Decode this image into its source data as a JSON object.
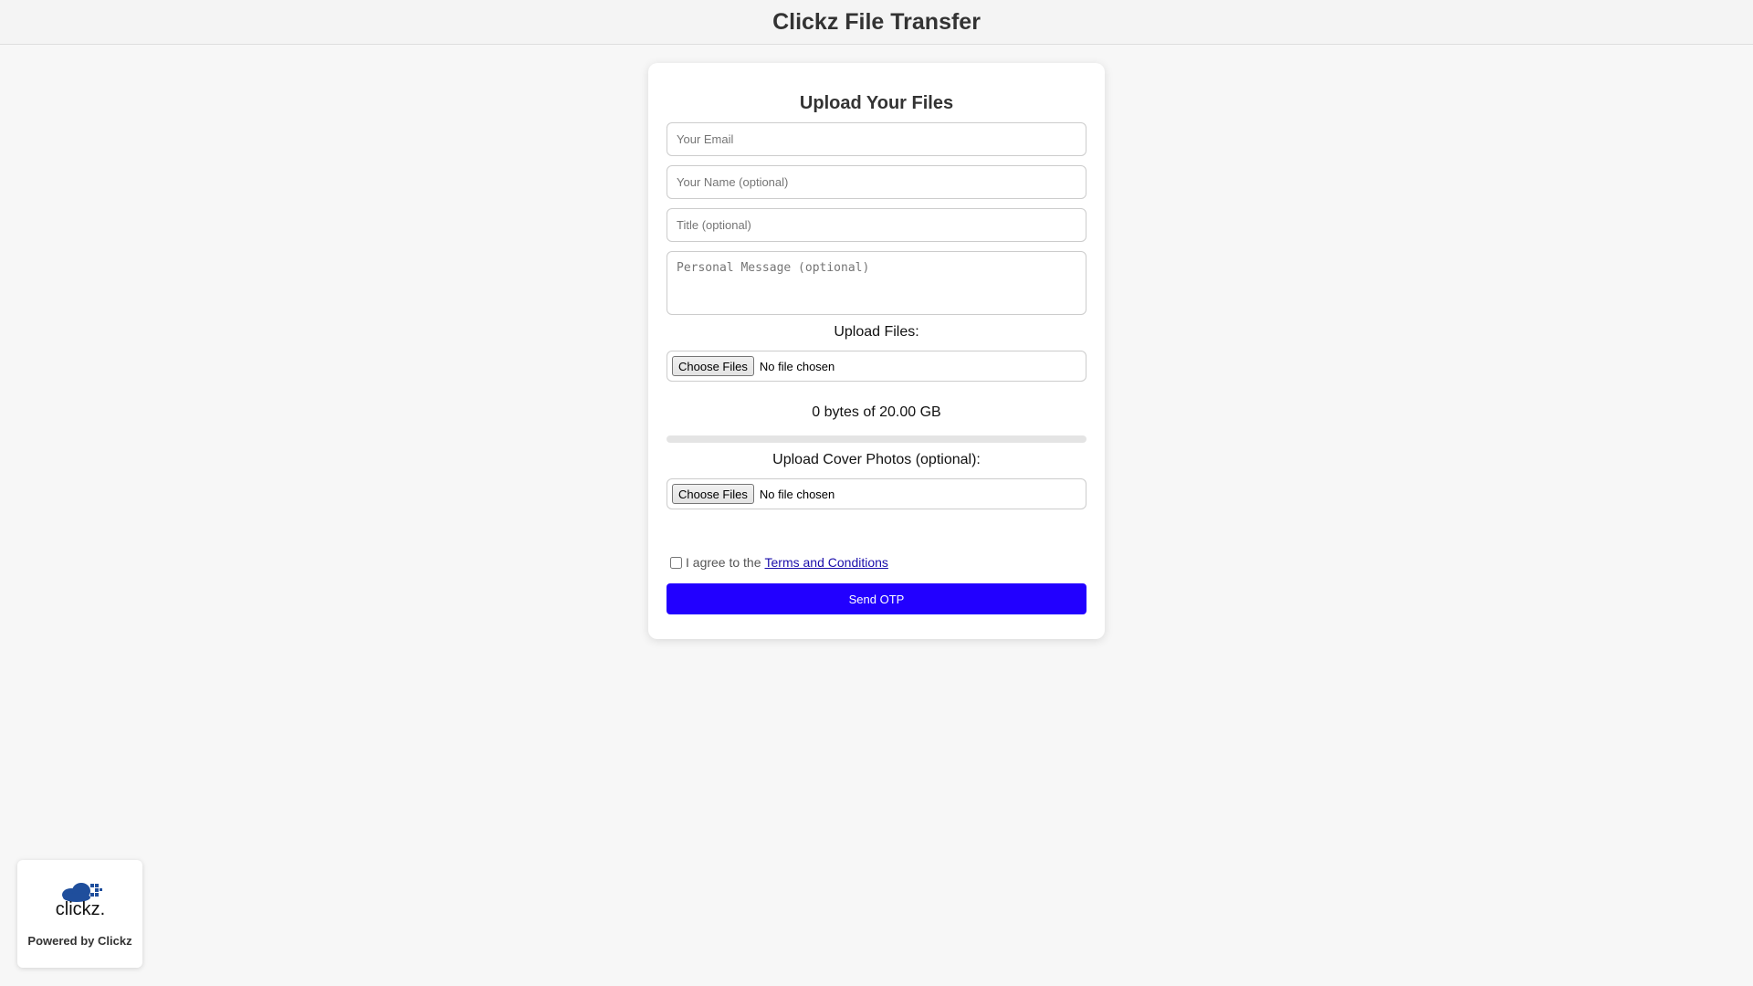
{
  "header": {
    "title": "Clickz File Transfer"
  },
  "form": {
    "title": "Upload Your Files",
    "email_placeholder": "Your Email",
    "name_placeholder": "Your Name (optional)",
    "title_placeholder": "Title (optional)",
    "message_placeholder": "Personal Message (optional)",
    "upload_files_label": "Upload Files:",
    "choose_files_label": "Choose Files",
    "no_file_text": "No file chosen",
    "bytes_text": "0 bytes of 20.00 GB",
    "upload_progress": 0,
    "cover_photos_label": "Upload Cover Photos (optional):",
    "terms_prefix": "I agree to the",
    "terms_link": "Terms and Conditions",
    "terms_checked": false,
    "send_button": "Send OTP"
  },
  "badge": {
    "logo_text": "clickz.",
    "logo_icon": "cloud-icon",
    "caption": "Powered by Clickz"
  },
  "colors": {
    "accent": "#2200ff",
    "logo_blue": "#1f4e9c"
  }
}
